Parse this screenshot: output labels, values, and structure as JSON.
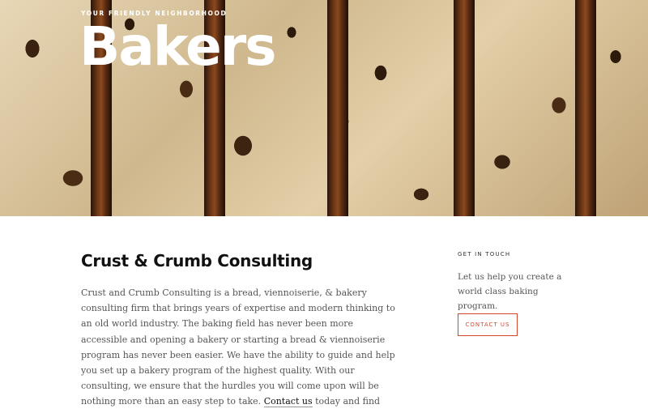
{
  "hero": {
    "eyebrow": "Your Friendly Neighborhood",
    "title": "Bakers"
  },
  "main": {
    "heading": "Crust & Crumb Consulting",
    "body_before_link": "Crust and Crumb Consulting is a bread, viennoiserie, & bakery consulting firm that brings years of expertise and modern thinking to an old world industry. The baking field has never been more accessible and opening a bakery or starting a bread & viennoiserie program has never been easier. We have the ability to guide and help you set up a bakery program of the highest quality. With our consulting, we ensure that the hurdles you will come upon will be nothing more than an easy step to take. ",
    "link_label": "Contact us",
    "body_after_link": " today and find out how we can help!"
  },
  "aside": {
    "eyebrow": "Get in Touch",
    "text": "Let us help you create a world class baking program.",
    "button_label": "Contact Us"
  },
  "colors": {
    "accent": "#d4472e",
    "heading": "#111111",
    "body_text": "#555555"
  }
}
